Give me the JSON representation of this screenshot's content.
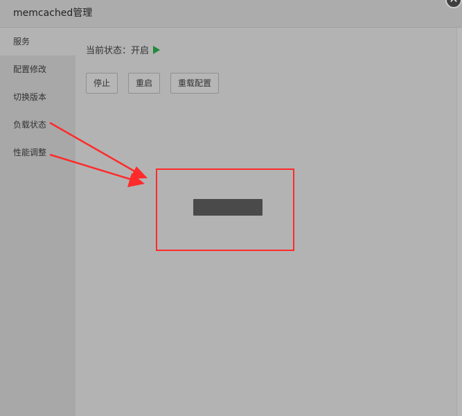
{
  "dialog": {
    "title": "memcached管理",
    "close_icon": "close-icon"
  },
  "sidebar": {
    "items": [
      {
        "label": "服务",
        "active": true
      },
      {
        "label": "配置修改",
        "active": false
      },
      {
        "label": "切换版本",
        "active": false
      },
      {
        "label": "负载状态",
        "active": false
      },
      {
        "label": "性能调整",
        "active": false
      }
    ]
  },
  "main": {
    "status_text": "当前状态：开启",
    "status_icon": "play-icon",
    "status_icon_color": "#1f8a3b",
    "buttons": {
      "stop": "停止",
      "restart": "重启",
      "reload": "重载配置"
    }
  },
  "annotation": {
    "color": "#ff2a2a",
    "arrow_icon": "arrow-icon",
    "box": "highlight-box"
  }
}
